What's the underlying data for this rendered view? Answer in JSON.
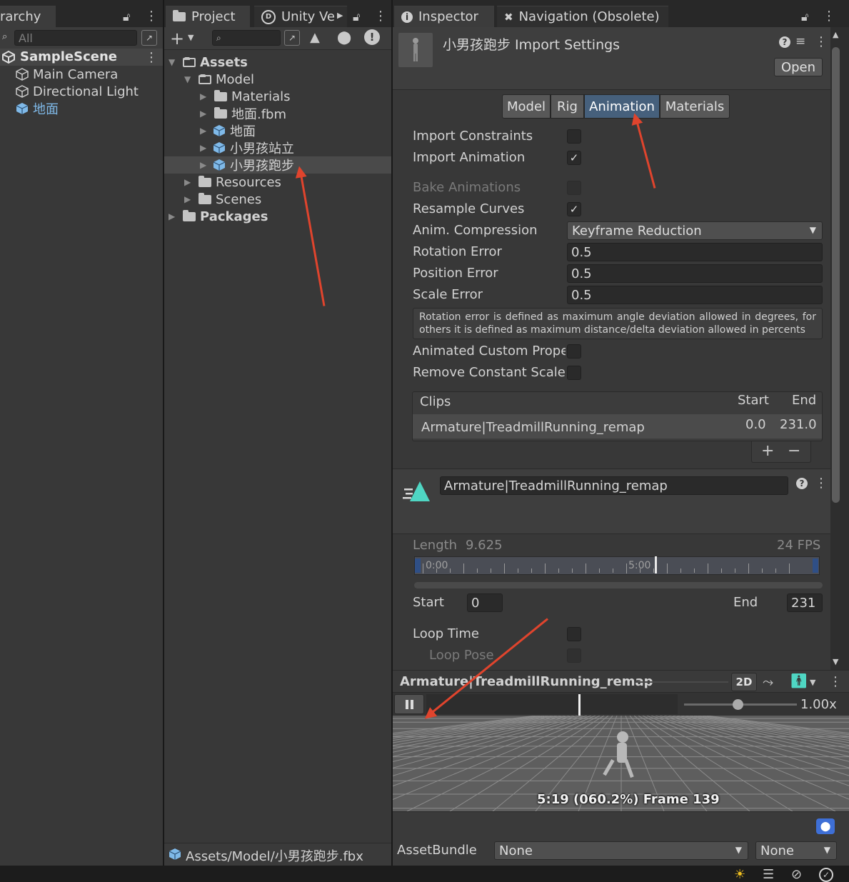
{
  "hierarchy": {
    "tab_label": "rarchy",
    "search_placeholder": "All",
    "scene_name": "SampleScene",
    "items": [
      "Main Camera",
      "Directional Light",
      "地面"
    ]
  },
  "project": {
    "tab_label": "Project",
    "tab2_label": "Unity Ve",
    "tree": {
      "assets": "Assets",
      "model": "Model",
      "materials": "Materials",
      "ground_fbm": "地面.fbm",
      "ground": "地面",
      "boy_stand": "小男孩站立",
      "boy_run": "小男孩跑步",
      "resources": "Resources",
      "scenes": "Scenes",
      "packages": "Packages"
    },
    "footer_path": "Assets/Model/小男孩跑步.fbx"
  },
  "inspector": {
    "tab_label": "Inspector",
    "tab2_label": "Navigation (Obsolete)",
    "title": "小男孩跑步 Import Settings",
    "open_button": "Open",
    "tabs": [
      "Model",
      "Rig",
      "Animation",
      "Materials"
    ],
    "selected_tab": "Animation",
    "props": {
      "import_constraints": "Import Constraints",
      "import_animation": "Import Animation",
      "bake_animations": "Bake Animations",
      "resample_curves": "Resample Curves",
      "anim_compression": "Anim. Compression",
      "anim_compression_value": "Keyframe Reduction",
      "rotation_error": "Rotation Error",
      "rotation_error_value": "0.5",
      "position_error": "Position Error",
      "position_error_value": "0.5",
      "scale_error": "Scale Error",
      "scale_error_value": "0.5",
      "help_text": "Rotation error is defined as maximum angle deviation allowed in degrees, for others it is defined as maximum distance/delta deviation allowed in percents",
      "animated_custom": "Animated Custom Proper",
      "remove_constant_scale": "Remove Constant Scale"
    },
    "clips": {
      "header": "Clips",
      "start_header": "Start",
      "end_header": "End",
      "rows": [
        {
          "name": "Armature|TreadmillRunning_remap",
          "start": "0.0",
          "end": "231.0"
        }
      ]
    },
    "clip": {
      "name": "Armature|TreadmillRunning_remap",
      "length_label": "Length",
      "length_value": "9.625",
      "fps": "24 FPS",
      "timeline_t0": "0:00",
      "timeline_t1": "5:00",
      "start_label": "Start",
      "start_value": "0",
      "end_label": "End",
      "end_value": "231",
      "loop_time": "Loop Time",
      "loop_pose": "Loop Pose"
    },
    "preview": {
      "title": "Armature|TreadmillRunning_remap",
      "mode_2d": "2D",
      "speed": "1.00x",
      "frame_info": "5:19 (060.2%) Frame 139"
    },
    "asset_bundle": {
      "label": "AssetBundle",
      "value1": "None",
      "value2": "None"
    }
  },
  "checkbox_states": {
    "import_constraints": false,
    "import_animation": true,
    "bake_animations": false,
    "resample_curves": true,
    "animated_custom": false,
    "remove_constant_scale": false,
    "loop_time": false,
    "loop_pose": false
  },
  "colors": {
    "selected_tab": "#46607c",
    "annotation_arrow": "#e0442d",
    "clip_icon": "#4fd6c3",
    "prefab_icon": "#7fb9e8"
  }
}
